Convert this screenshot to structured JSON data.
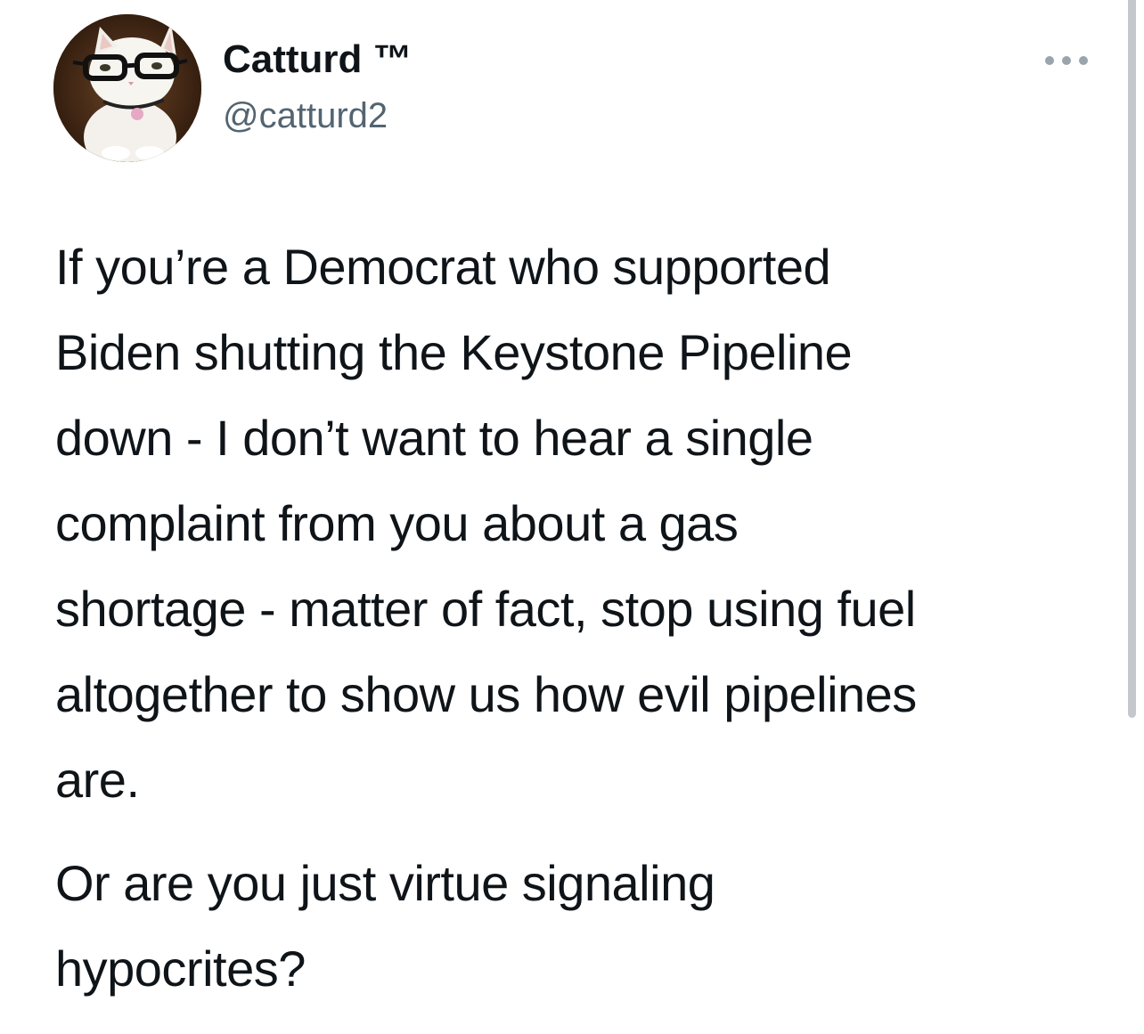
{
  "author": {
    "display_name": "Catturd ™",
    "handle": "@catturd2",
    "avatar_icon": "cat-with-glasses-avatar"
  },
  "header": {
    "more_icon": "more-options-icon"
  },
  "tweet": {
    "paragraphs": [
      "If you’re a Democrat who supported\nBiden shutting the Keystone Pipeline\ndown - I don’t want to hear a single\ncomplaint from you about a gas\nshortage - matter of fact, stop using fuel\naltogether to show us how evil pipelines\nare.",
      "Or are you just virtue signaling\nhypocrites?"
    ]
  },
  "colors": {
    "text_primary": "#0f1419",
    "text_secondary": "#536471",
    "background": "#ffffff",
    "scrollbar": "#c4c8cc"
  }
}
